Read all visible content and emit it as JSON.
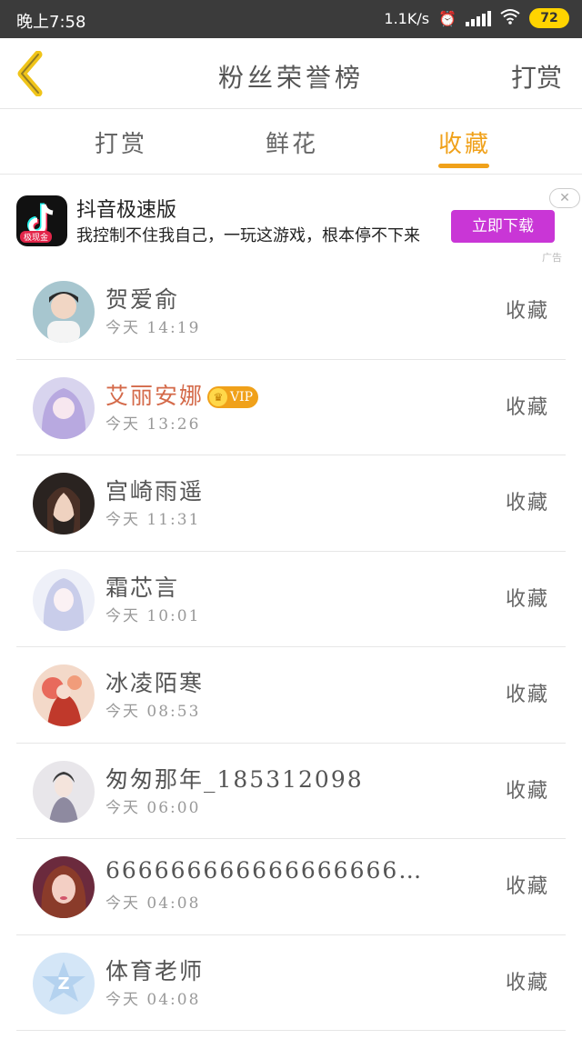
{
  "status_bar": {
    "time": "晚上7:58",
    "net_speed": "1.1K/s",
    "battery": "72"
  },
  "header": {
    "title": "粉丝荣誉榜",
    "right_action": "打赏"
  },
  "tabs": [
    {
      "label": "打赏",
      "active": false
    },
    {
      "label": "鲜花",
      "active": false
    },
    {
      "label": "收藏",
      "active": true
    }
  ],
  "ad": {
    "app_name": "抖音极速版",
    "app_badge": "极现金",
    "description": "我控制不住我自己，一玩这游戏，根本停不下来",
    "button": "立即下载",
    "label": "广告",
    "close": "✕"
  },
  "rows": [
    {
      "name": "贺爱俞",
      "time": "今天 14:19",
      "action": "收藏",
      "vip": false
    },
    {
      "name": "艾丽安娜",
      "time": "今天 13:26",
      "action": "收藏",
      "vip": true,
      "vip_label": "VIP"
    },
    {
      "name": "宫崎雨遥",
      "time": "今天 11:31",
      "action": "收藏",
      "vip": false
    },
    {
      "name": "霜芯言",
      "time": "今天 10:01",
      "action": "收藏",
      "vip": false
    },
    {
      "name": "冰凌陌寒",
      "time": "今天 08:53",
      "action": "收藏",
      "vip": false
    },
    {
      "name": "匆匆那年_185312098",
      "time": "今天 06:00",
      "action": "收藏",
      "vip": false
    },
    {
      "name": "666666666666666666…",
      "time": "今天 04:08",
      "action": "收藏",
      "vip": false
    },
    {
      "name": "体育老师",
      "time": "今天 04:08",
      "action": "收藏",
      "vip": false
    }
  ],
  "colors": {
    "accent": "#f0a11a",
    "ad_button": "#c936d6",
    "status_bar": "#3b3b3b",
    "vip_name": "#d46a4a"
  }
}
